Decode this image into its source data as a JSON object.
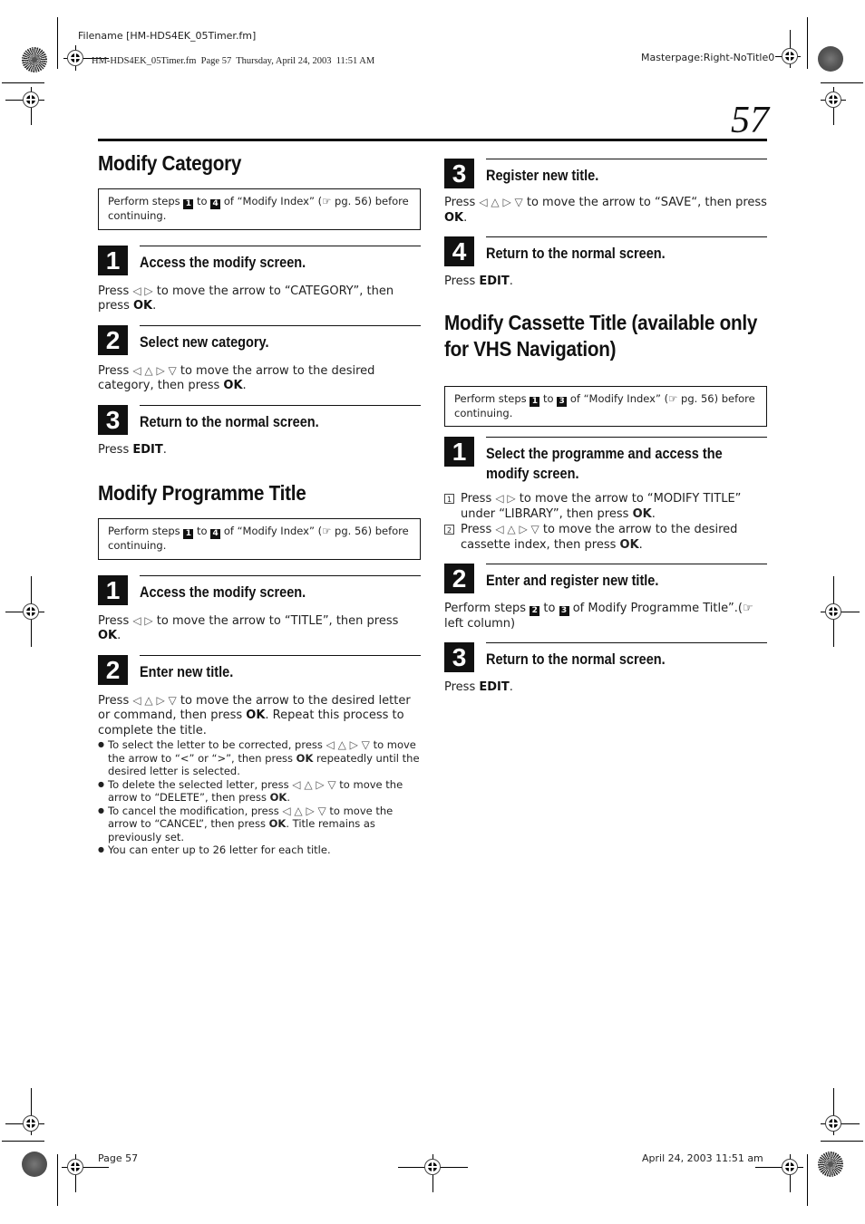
{
  "header": {
    "filename": "Filename [HM-HDS4EK_05Timer.fm]",
    "print_info": "HM-HDS4EK_05Timer.fm  Page 57  Thursday, April 24, 2003  11:51 AM",
    "masterpage": "Masterpage:Right-NoTitle0",
    "page_number": "57"
  },
  "footer": {
    "page_label": "Page 57",
    "date": "April 24, 2003 11:51 am"
  },
  "icons": {
    "arrows_lr": "◁ ▷",
    "arrows_all": "◁ △ ▷ ▽",
    "reference": "☞"
  },
  "left": {
    "category": {
      "title": "Modify Category",
      "note": {
        "prefix": "Perform steps",
        "from": "1",
        "to_word": "to",
        "to": "4",
        "middle": "of “Modify Index” (",
        "ref": "☞",
        "suffix": " pg. 56) before continuing."
      },
      "steps": [
        {
          "num": "1",
          "title": "Access the modify screen.",
          "pre": "Press",
          "arrows": "◁ ▷",
          "post": "to move the arrow to “CATEGORY”, then press",
          "bold": "OK",
          "end": "."
        },
        {
          "num": "2",
          "title": "Select new category.",
          "pre": "Press",
          "arrows": "◁ △ ▷ ▽",
          "post": "to move the arrow to the desired category, then press",
          "bold": "OK",
          "end": "."
        },
        {
          "num": "3",
          "title": "Return to the normal screen.",
          "pre": "Press",
          "bold": "EDIT",
          "end": "."
        }
      ]
    },
    "programme": {
      "title": "Modify Programme Title",
      "note": {
        "prefix": "Perform steps",
        "from": "1",
        "to_word": "to",
        "to": "4",
        "middle": "of “Modify Index” (",
        "ref": "☞",
        "suffix": " pg. 56) before continuing."
      },
      "steps": [
        {
          "num": "1",
          "title": "Access the modify screen.",
          "pre": "Press",
          "arrows": "◁ ▷",
          "post": "to move the arrow to “TITLE”, then press",
          "bold": "OK",
          "end": "."
        },
        {
          "num": "2",
          "title": "Enter new title.",
          "pre": "Press",
          "arrows": "◁ △ ▷ ▽",
          "post": "to move the arrow to the desired letter or command, then press",
          "bold": "OK",
          "end": ". Repeat this process to complete the title.",
          "bullets": [
            {
              "a": "To select the letter to be corrected, press",
              "arrows": "◁ △ ▷ ▽",
              "b": "to move the arrow to “<” or “>”, then press",
              "bold": "OK",
              "c": "repeatedly until the desired letter is selected."
            },
            {
              "a": "To delete the selected letter, press",
              "arrows": "◁ △ ▷ ▽",
              "b": "to move the arrow to “DELETE”, then press",
              "bold": "OK",
              "c": "."
            },
            {
              "a": "To cancel the modification, press",
              "arrows": "◁ △ ▷ ▽",
              "b": "to move the arrow to “CANCEL”, then press",
              "bold": "OK",
              "c": ". Title remains as previously set."
            },
            {
              "a": "You can enter up to 26 letter for each title."
            }
          ]
        }
      ]
    }
  },
  "right": {
    "programme_cont": {
      "steps": [
        {
          "num": "3",
          "title": "Register new title.",
          "pre": "Press",
          "arrows": "◁ △ ▷ ▽",
          "post": "to move the arrow to “SAVE“, then press",
          "bold": "OK",
          "end": "."
        },
        {
          "num": "4",
          "title": "Return to the normal screen.",
          "pre": "Press",
          "bold": "EDIT",
          "end": "."
        }
      ]
    },
    "cassette": {
      "title": "Modify Cassette Title (available only for VHS Navigation)",
      "note": {
        "prefix": "Perform steps",
        "from": "1",
        "to_word": "to",
        "to": "3",
        "middle": "of “Modify Index” (",
        "ref": "☞",
        "suffix": " pg. 56) before continuing."
      },
      "steps": [
        {
          "num": "1",
          "title": "Select the programme and access the modify screen.",
          "subs": [
            {
              "n": "1",
              "pre": "Press",
              "arrows": "◁ ▷",
              "post": "to move the arrow to “MODIFY TITLE” under “LIBRARY”, then press",
              "bold": "OK",
              "end": "."
            },
            {
              "n": "2",
              "pre": "Press",
              "arrows": "◁ △ ▷ ▽",
              "post": "to move the arrow to the desired cassette index, then press",
              "bold": "OK",
              "end": "."
            }
          ]
        },
        {
          "num": "2",
          "title": "Enter and register new title.",
          "pre": "Perform steps",
          "from": "2",
          "to_word": "to",
          "to": "3",
          "post": "of Modify Programme Title”.(",
          "ref": "☞",
          "end": " left column)"
        },
        {
          "num": "3",
          "title": "Return to the normal screen.",
          "pre": "Press",
          "bold": "EDIT",
          "end": "."
        }
      ]
    }
  }
}
